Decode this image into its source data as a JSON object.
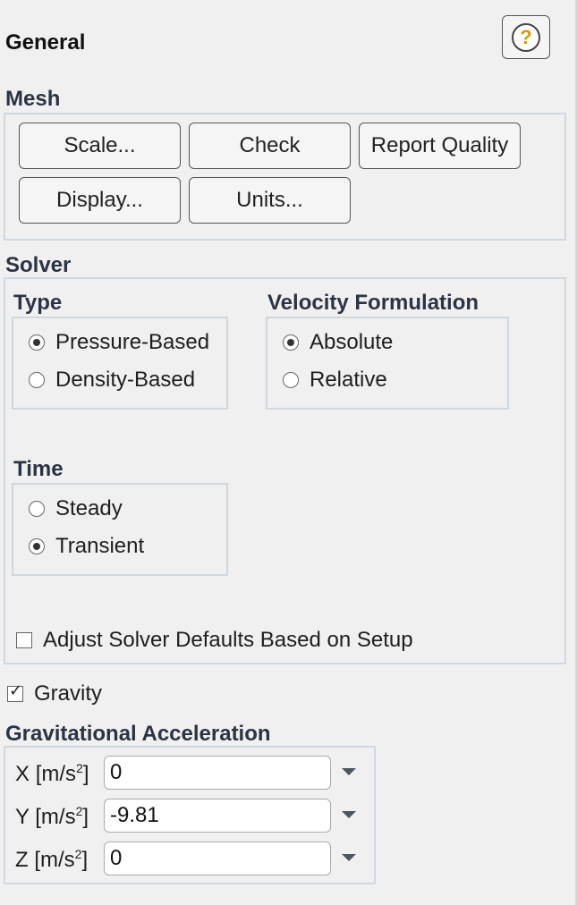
{
  "header": {
    "title": "General",
    "help_icon": "?"
  },
  "mesh": {
    "label": "Mesh",
    "buttons": [
      "Scale...",
      "Check",
      "Report Quality",
      "Display...",
      "Units..."
    ]
  },
  "solver": {
    "label": "Solver",
    "type": {
      "label": "Type",
      "options": [
        "Pressure-Based",
        "Density-Based"
      ],
      "selected": "Pressure-Based"
    },
    "velocity": {
      "label": "Velocity Formulation",
      "options": [
        "Absolute",
        "Relative"
      ],
      "selected": "Absolute"
    },
    "time": {
      "label": "Time",
      "options": [
        "Steady",
        "Transient"
      ],
      "selected": "Transient"
    },
    "adjust_defaults": {
      "label": "Adjust Solver Defaults Based on Setup",
      "checked": false
    }
  },
  "gravity": {
    "label": "Gravity",
    "checked": true
  },
  "gravitational_acceleration": {
    "label": "Gravitational Acceleration",
    "fields": [
      {
        "axis": "X",
        "unit_pre": "[m/s",
        "unit_sup": "2",
        "unit_post": "]",
        "value": "0"
      },
      {
        "axis": "Y",
        "unit_pre": "[m/s",
        "unit_sup": "2",
        "unit_post": "]",
        "value": "-9.81"
      },
      {
        "axis": "Z",
        "unit_pre": "[m/s",
        "unit_sup": "2",
        "unit_post": "]",
        "value": "0"
      }
    ]
  }
}
